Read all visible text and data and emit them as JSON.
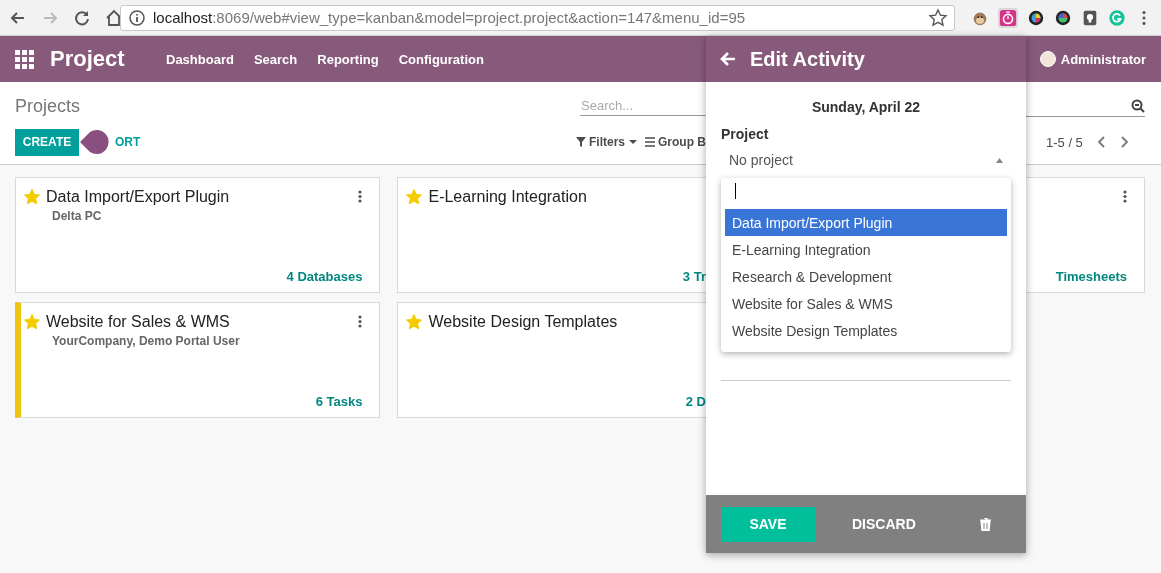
{
  "browser": {
    "url_host": "localhost",
    "url_path": ":8069/web#view_type=kanban&model=project.project&action=147&menu_id=95"
  },
  "navbar": {
    "app": "Project",
    "menu": [
      "Dashboard",
      "Search",
      "Reporting",
      "Configuration"
    ],
    "user": "Administrator"
  },
  "control_panel": {
    "title": "Projects",
    "search": {
      "placeholder": "Search..."
    },
    "create": "CREATE",
    "import_partial": "ORT",
    "filters": "Filters",
    "group_by": "Group B",
    "pager": "1-5 / 5"
  },
  "kanban": {
    "rows": [
      [
        {
          "kind": "full",
          "title": "Data Import/Export Plugin",
          "subtitle": "Delta PC",
          "starred": true,
          "count": "4",
          "label": "Databases"
        },
        {
          "kind": "left_part",
          "title": "E-Learning Integration",
          "starred": true,
          "count": "3",
          "label": "Tr"
        },
        {
          "kind": "right_part",
          "label": "Timesheets"
        }
      ],
      [
        {
          "kind": "full",
          "title": "Website for Sales & WMS",
          "subtitle": "YourCompany, Demo Portal User",
          "starred": true,
          "color": "#f0c30f",
          "count": "6",
          "label": "Tasks"
        },
        {
          "kind": "left_part",
          "title": "Website Design Templates",
          "starred": true,
          "count": "2",
          "label": "D"
        }
      ]
    ]
  },
  "popup": {
    "title": "Edit Activity",
    "date": "Sunday, April 22",
    "field_label": "Project",
    "select_value": "No project",
    "options": [
      {
        "label": "Data Import/Export Plugin",
        "selected": true
      },
      {
        "label": "E-Learning Integration",
        "selected": false
      },
      {
        "label": "Research & Development",
        "selected": false
      },
      {
        "label": "Website for Sales & WMS",
        "selected": false
      },
      {
        "label": "Website Design Templates",
        "selected": false
      }
    ],
    "save": "SAVE",
    "discard": "DISCARD"
  }
}
